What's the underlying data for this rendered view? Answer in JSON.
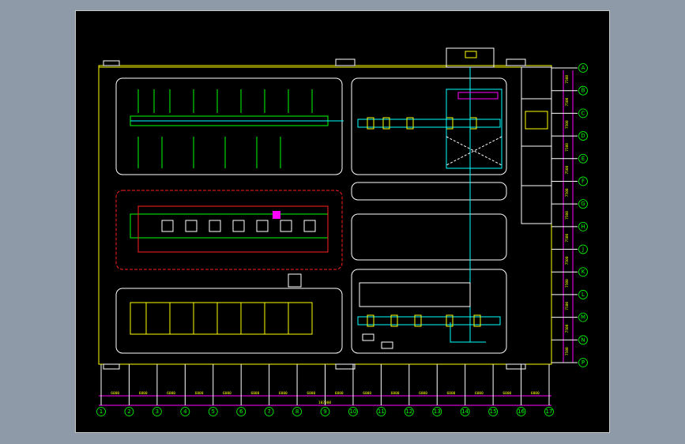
{
  "drawing": {
    "colors": {
      "background": "#000000",
      "wall": "#ffff00",
      "equipment": "#ffffff",
      "conveyor": "#00ffff",
      "dimension": "#ff00ff",
      "axis_bubble": "#00ff00",
      "zone_outline": "#ff2020"
    },
    "bottom_axes": [
      "1",
      "2",
      "3",
      "4",
      "5",
      "6",
      "7",
      "8",
      "9",
      "10",
      "11",
      "12",
      "13",
      "14",
      "15",
      "16",
      "17"
    ],
    "right_axes": [
      "A",
      "B",
      "C",
      "D",
      "E",
      "F",
      "G",
      "H",
      "J",
      "K",
      "L",
      "M",
      "N",
      "P"
    ],
    "bottom_spans": [
      "6000",
      "6000",
      "6000",
      "6000",
      "6000",
      "6000",
      "6000",
      "6000",
      "6000",
      "6000",
      "6000",
      "6000",
      "6000",
      "6000",
      "6000",
      "6000"
    ],
    "overall_length": "102000",
    "right_spans": [
      "7500",
      "7500",
      "7500",
      "7500",
      "7500",
      "7500",
      "7500",
      "7500",
      "7500",
      "7500",
      "7500",
      "7500",
      "7500"
    ],
    "overall_width": "",
    "area_label_left": "",
    "area_label_right": ""
  }
}
